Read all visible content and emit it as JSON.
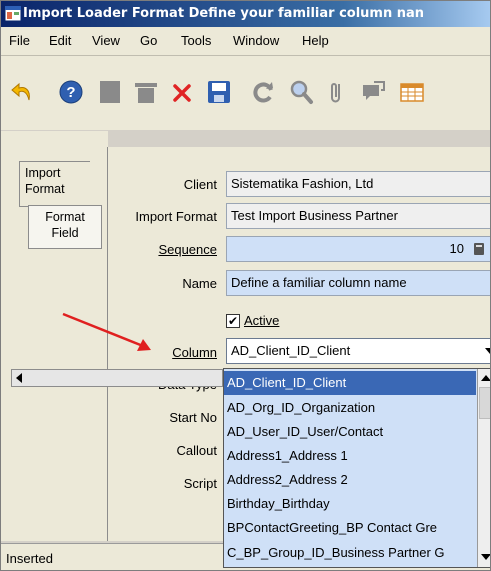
{
  "window": {
    "title": "Import Loader Format  Define your familiar column nan"
  },
  "menu": {
    "items": [
      "File",
      "Edit",
      "View",
      "Go",
      "Tools",
      "Window",
      "Help"
    ]
  },
  "toolbar": {
    "buttons": [
      "undo-icon",
      "help-icon",
      "new-icon",
      "delete-icon",
      "delete-x-icon",
      "save-icon",
      "refresh-icon",
      "find-icon",
      "attachment-icon",
      "chat-icon",
      "grid-icon"
    ]
  },
  "tabs": {
    "import_format": "Import\nFormat",
    "format_field": "Format\nField"
  },
  "form": {
    "client_label": "Client",
    "client_value": "Sistematika Fashion, Ltd",
    "import_format_label": "Import Format",
    "import_format_value": "Test Import Business Partner",
    "sequence_label": "Sequence",
    "sequence_value": "10",
    "name_label": "Name",
    "name_value": "Define a familiar column name",
    "active_label": "Active",
    "active_checked": true,
    "column_label": "Column",
    "column_value": "AD_Client_ID_Client",
    "data_type_label": "Data Type",
    "start_no_label": "Start No",
    "callout_label": "Callout",
    "script_label": "Script"
  },
  "dropdown": {
    "options": [
      "AD_Client_ID_Client",
      "AD_Org_ID_Organization",
      "AD_User_ID_User/Contact",
      "Address1_Address 1",
      "Address2_Address 2",
      "Birthday_Birthday",
      "BPContactGreeting_BP Contact Gre",
      "C_BP_Group_ID_Business Partner G"
    ],
    "selected": "AD_Client_ID_Client"
  },
  "status": {
    "text": "Inserted"
  },
  "colors": {
    "title_bar": "#0a246a",
    "selection": "#3a68b5",
    "mandatory_field": "#cfe0f7",
    "arrow": "#e02020"
  }
}
